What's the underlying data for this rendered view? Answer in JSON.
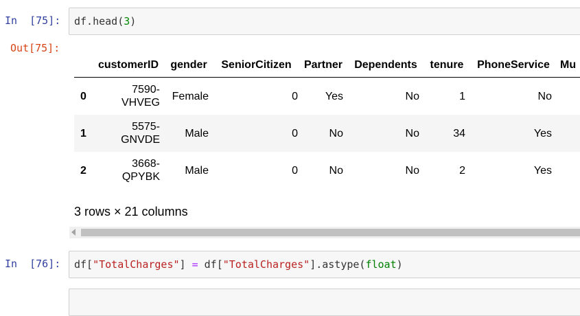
{
  "cells": [
    {
      "in_label": "In",
      "in_number": "[75]:",
      "code": {
        "p1": "df.head(",
        "p2": "3",
        "p3": ")"
      }
    },
    {
      "in_label": "In",
      "in_number": "[76]:",
      "code": {
        "p1": "df[",
        "p2": "\"TotalCharges\"",
        "p3": "] ",
        "p4": "=",
        "p5": " df[",
        "p6": "\"TotalCharges\"",
        "p7": "].astype(",
        "p8": "float",
        "p9": ")"
      }
    }
  ],
  "output": {
    "out_label": "Out[75]:",
    "dataframe": {
      "columns": [
        "customerID",
        "gender",
        "SeniorCitizen",
        "Partner",
        "Dependents",
        "tenure",
        "PhoneService",
        "Mu"
      ],
      "rows": [
        {
          "index": "0",
          "customerID": [
            "7590-",
            "VHVEG"
          ],
          "gender": "Female",
          "SeniorCitizen": "0",
          "Partner": "Yes",
          "Dependents": "No",
          "tenure": "1",
          "PhoneService": "No"
        },
        {
          "index": "1",
          "customerID": [
            "5575-",
            "GNVDE"
          ],
          "gender": "Male",
          "SeniorCitizen": "0",
          "Partner": "No",
          "Dependents": "No",
          "tenure": "34",
          "PhoneService": "Yes"
        },
        {
          "index": "2",
          "customerID": [
            "3668-",
            "QPYBK"
          ],
          "gender": "Male",
          "SeniorCitizen": "0",
          "Partner": "No",
          "Dependents": "No",
          "tenure": "2",
          "PhoneService": "Yes"
        }
      ]
    },
    "shape_text": "3 rows × 21 columns"
  },
  "colors": {
    "prompt_in": "#303F9F",
    "prompt_out": "#D84315",
    "number": "#008800",
    "string": "#BA2121",
    "operator": "#AA22FF",
    "builtin": "#008000"
  }
}
